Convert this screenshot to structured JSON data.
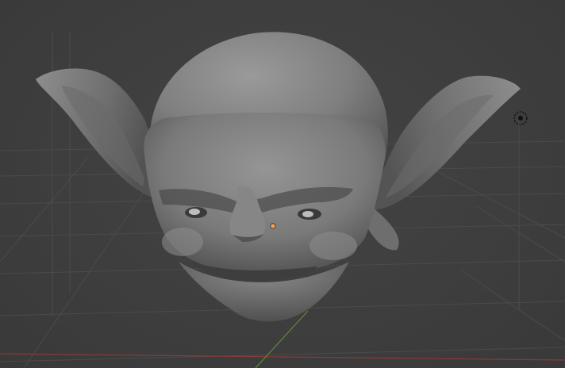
{
  "viewport": {
    "background": "#3d3d3d",
    "grid_color": "#4a4a4a",
    "x_axis_color": "#8a3a3a",
    "y_axis_color": "#5d8a3a"
  },
  "scene": {
    "object": "goblin-head-sculpt",
    "material_color": "#8c8c8c",
    "origin_marker_color": "#f0a050",
    "light_marker": "light-icon"
  }
}
